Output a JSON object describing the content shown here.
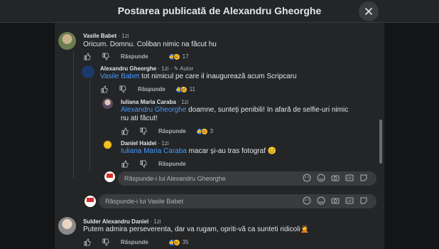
{
  "header": {
    "title": "Postarea publicată de Alexandru Gheorghe"
  },
  "actions_labels": {
    "reply": "Răspunde"
  },
  "comments": [
    {
      "name": "Vasile Babet",
      "time": "1zi",
      "text": "Oricum. Domnu. Coliban nimic na făcut hu",
      "count": "17"
    },
    {
      "name": "Alexandru Gheorghe",
      "time": "1zi",
      "badge": "Autor",
      "mention": "Vasile Babet",
      "text": " tot nimicul pe care il inaugurează acum Scripcaru",
      "count": "11"
    },
    {
      "name": "Iuliana Maria Caraba",
      "time": "1zi",
      "mention": "Alexandru Gheorghe",
      "text": " doamne, sunteți penibili! In afară de selfie-uri nimic nu ati făcut!",
      "count": "3"
    },
    {
      "name": "Daniel Haidei",
      "time": "1zi",
      "mention": "Iuliana Maria Caraba",
      "text": " macar și-au tras fotograf 😊"
    },
    {
      "name": "Sulder Alexandru Daniel",
      "time": "1zi",
      "text": "Putem admira perseverenta, dar va rugam, opriti-vă ca sunteti ridicoli🤦",
      "count": "35"
    }
  ],
  "reply_boxes": {
    "inner": "Răspunde-i lui Alexandru Gheorghe",
    "outer": "Răspunde-i lui Vasile Babet"
  },
  "colors": {
    "accent": "#4599ff",
    "like": "#1877f2",
    "haha": "#f7b125"
  },
  "icons": [
    "close-icon",
    "like-icon",
    "dislike-icon",
    "emoji-icon",
    "camera-icon",
    "gif-icon",
    "sticker-icon",
    "pencil-icon"
  ]
}
